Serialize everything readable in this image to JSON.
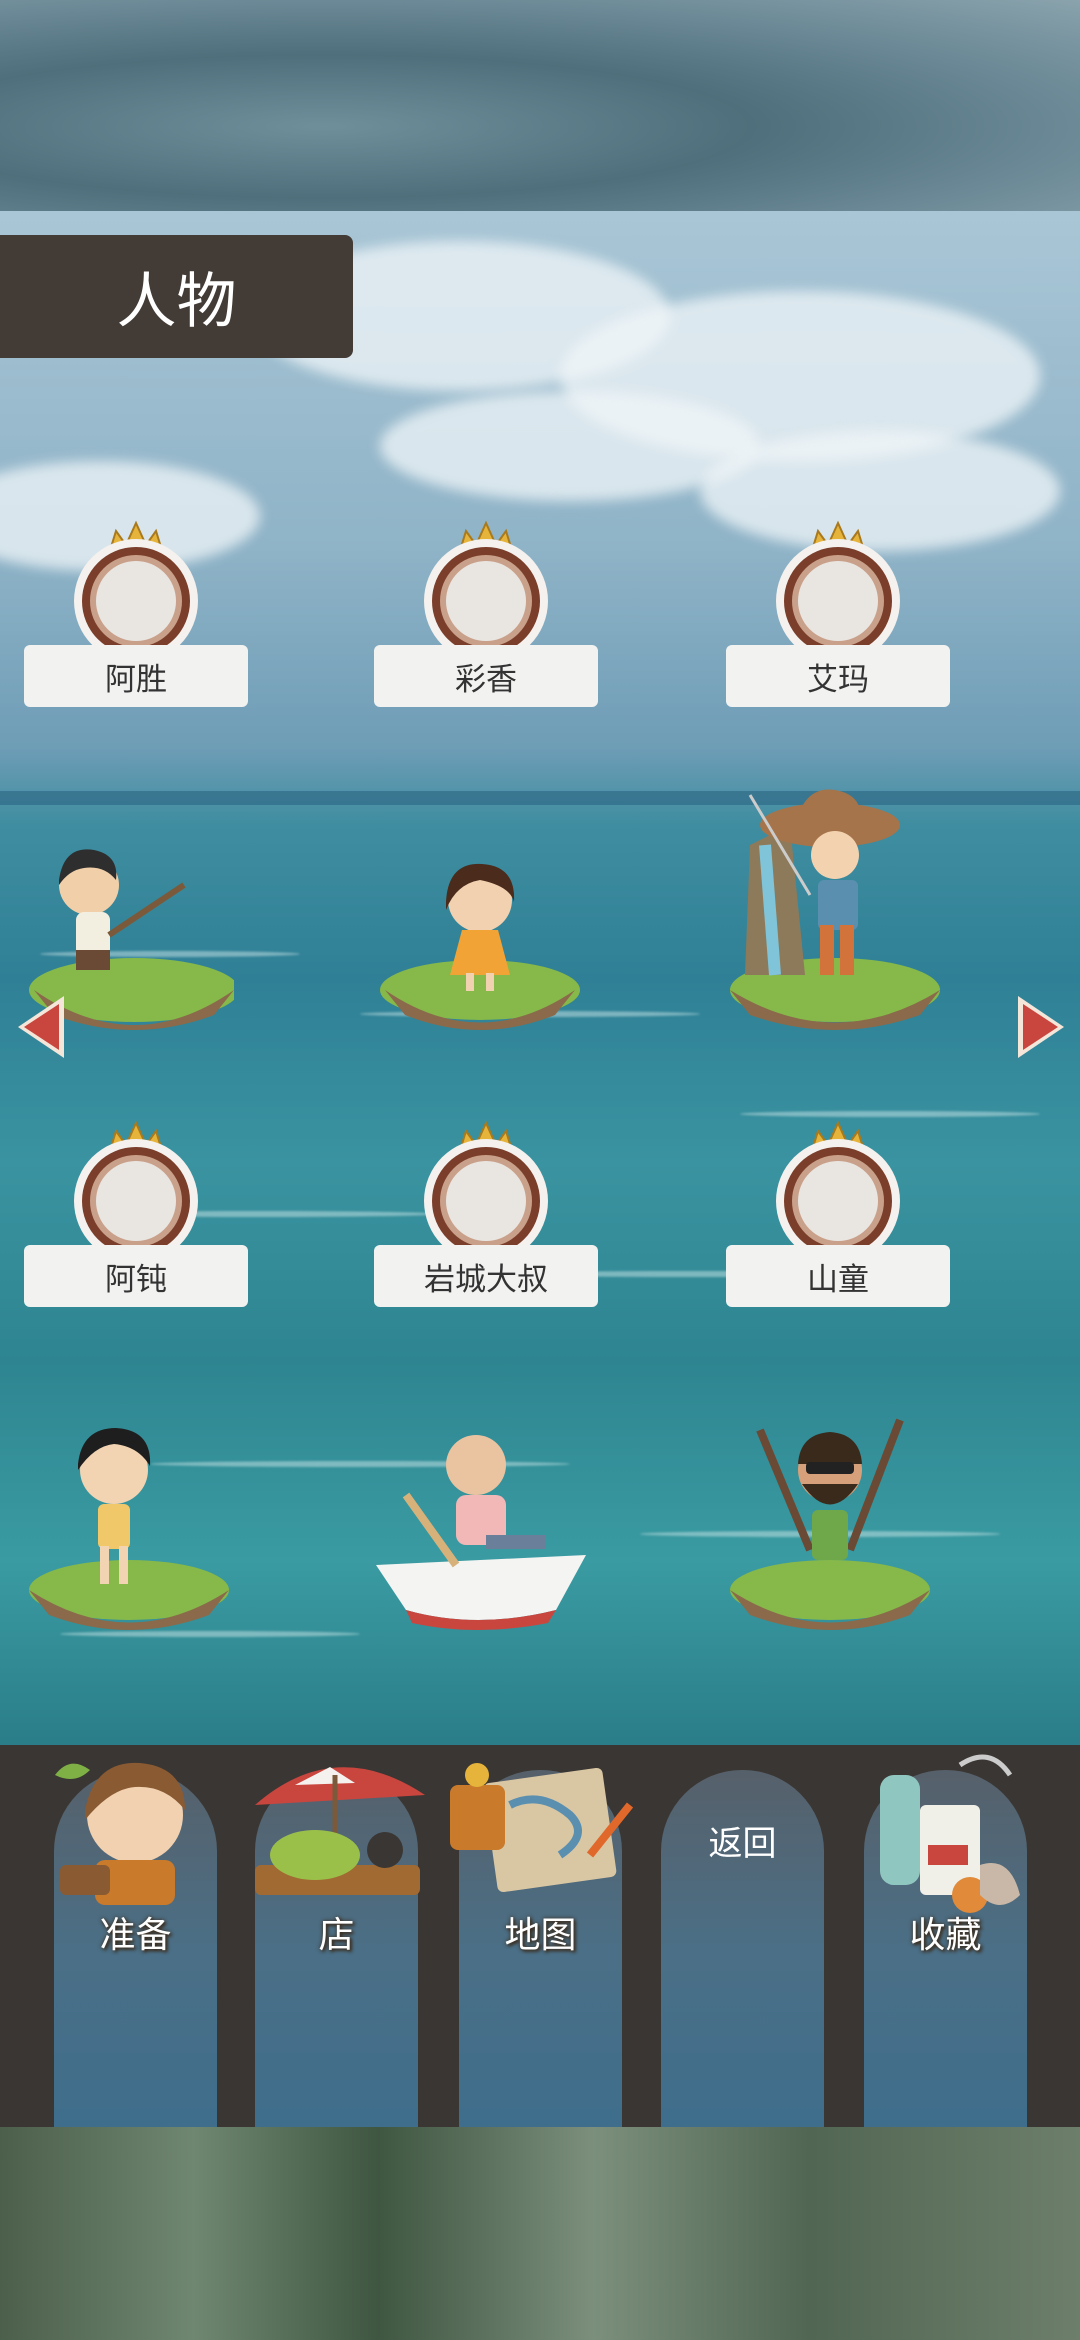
{
  "header": {
    "title": "人物"
  },
  "characters": [
    {
      "name": "阿胜"
    },
    {
      "name": "彩香"
    },
    {
      "name": "艾玛"
    },
    {
      "name": "阿钝"
    },
    {
      "name": "岩城大叔"
    },
    {
      "name": "山童"
    }
  ],
  "nav": {
    "prepare": "准备",
    "shop": "店",
    "map": "地图",
    "back": "返回",
    "collection": "收藏"
  },
  "colors": {
    "title_bg": "#433b36",
    "arrow": "#c9463f",
    "medal_gold": "#e6b43a",
    "nav_bg": "#3a3633"
  }
}
